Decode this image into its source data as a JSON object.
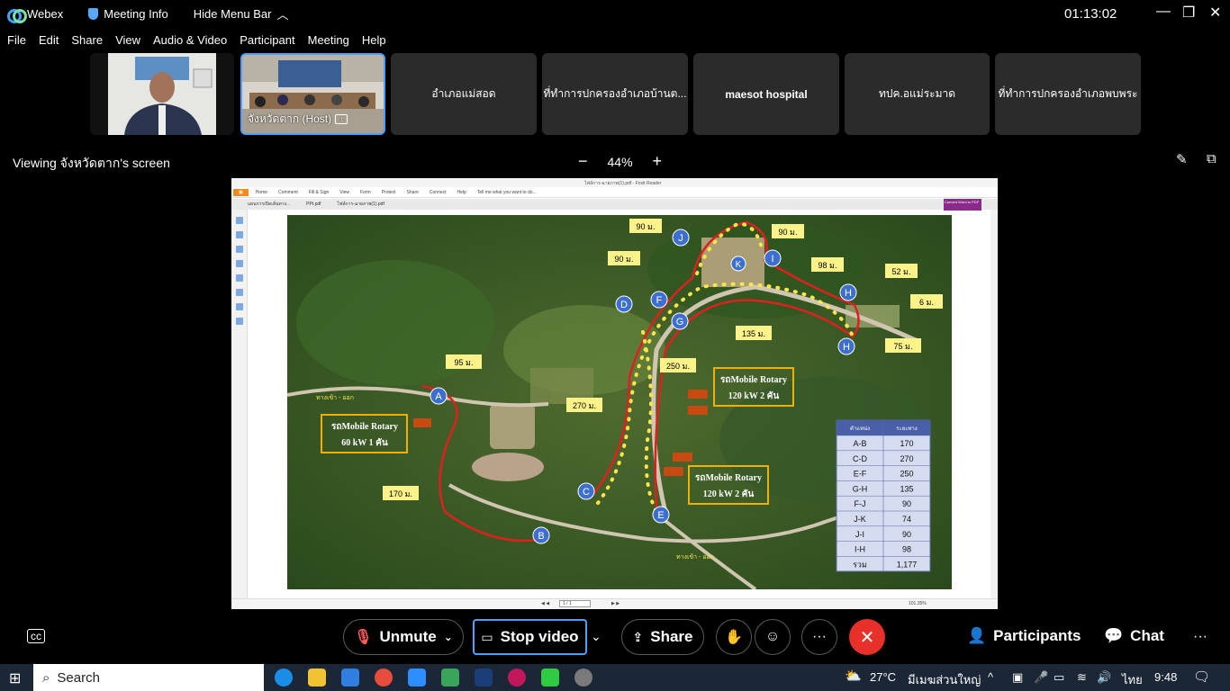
{
  "titlebar": {
    "app_name": "Webex",
    "meeting_info": "Meeting Info",
    "hide_menu": "Hide Menu Bar",
    "clock": "01:13:02"
  },
  "menu": [
    "File",
    "Edit",
    "Share",
    "View",
    "Audio & Video",
    "Participant",
    "Meeting",
    "Help"
  ],
  "participants": [
    {
      "name": "",
      "type": "video-person"
    },
    {
      "name": "จังหวัดตาก (Host)",
      "type": "video-room"
    },
    {
      "name": "อำเภอแม่สอด"
    },
    {
      "name": "ที่ทำการปกครองอำเภอบ้านต..."
    },
    {
      "name": "maesot hospital"
    },
    {
      "name": "ทปค.อแม่ระมาด"
    },
    {
      "name": "ที่ทำการปกครองอำเภอพบพระ"
    }
  ],
  "viewing": {
    "label": "Viewing จังหวัดตาก's screen",
    "zoom": "44%",
    "minus": "−",
    "plus": "+"
  },
  "reader": {
    "title": "ไฟล์การ-ฉายภาพ(1).pdf - Foxit Reader",
    "ribbon": [
      "Home",
      "Comment",
      "Fill & Sign",
      "View",
      "Form",
      "Protect",
      "Share",
      "Connect",
      "Help",
      "Tell me what you want to do..."
    ],
    "tabs": [
      "แผนการเปิดเส้นทาง...",
      "PPt.pdf",
      "ไฟล์การ-ฉายภาพ(1).pdf"
    ],
    "convert": "Convert Word to PDF",
    "page": "1 / 1",
    "zoom": "101.35%"
  },
  "map": {
    "distance_labels": [
      "90 ม.",
      "90 ม.",
      "90 ม.",
      "98 ม.",
      "52 ม.",
      "6 ม.",
      "135 ม.",
      "75 ม.",
      "250 ม.",
      "95 ม.",
      "270 ม.",
      "170 ม."
    ],
    "markers": [
      "A",
      "B",
      "C",
      "D",
      "E",
      "F",
      "G",
      "H",
      "H",
      "I",
      "J",
      "K"
    ],
    "boxes": [
      {
        "line1": "รถMobile Rotary",
        "line2": "60 kW 1 คัน"
      },
      {
        "line1": "รถMobile Rotary",
        "line2": "120 kW 2 คัน"
      },
      {
        "line1": "รถMobile Rotary",
        "line2": "120 kW 2 คัน"
      }
    ],
    "road_labels": [
      "ทางเข้า - ออก",
      "ทางเข้า - ออก"
    ],
    "table": {
      "headers": [
        "ตำแหน่ง",
        "ระยะทาง"
      ],
      "rows": [
        [
          "A-B",
          "170"
        ],
        [
          "C-D",
          "270"
        ],
        [
          "E-F",
          "250"
        ],
        [
          "G-H",
          "135"
        ],
        [
          "F-J",
          "90"
        ],
        [
          "J-K",
          "74"
        ],
        [
          "J-I",
          "90"
        ],
        [
          "I-H",
          "98"
        ],
        [
          "รวม",
          "1,177"
        ]
      ]
    }
  },
  "controls": {
    "unmute": "Unmute",
    "stop_video": "Stop video",
    "share": "Share",
    "participants": "Participants",
    "chat": "Chat"
  },
  "taskbar": {
    "search": "Search",
    "weather": "27°C",
    "location": "มีเมฆส่วนใหญ่",
    "lang": "ไทย",
    "time": "9:48"
  }
}
